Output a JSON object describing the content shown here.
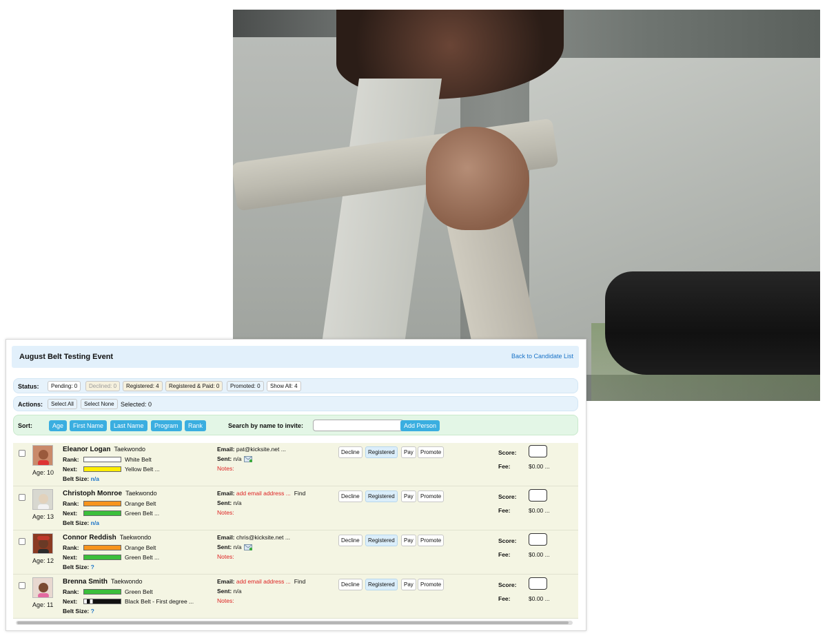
{
  "event": {
    "title": "August Belt Testing Event",
    "back_link": "Back to Candidate List"
  },
  "status": {
    "label": "Status:",
    "chips": [
      "Pending: 0",
      "Declined: 0",
      "Registered: 4",
      "Registered & Paid: 0",
      "Promoted: 0",
      "Show All: 4"
    ]
  },
  "actions": {
    "label": "Actions:",
    "select_all": "Select All",
    "select_none": "Select None",
    "selected": "Selected: 0"
  },
  "sort": {
    "label": "Sort:",
    "buttons": [
      "Age",
      "First Name",
      "Last Name",
      "Program",
      "Rank"
    ],
    "search_label": "Search by name to invite:",
    "add_person": "Add Person"
  },
  "row_labels": {
    "rank": "Rank:",
    "next": "Next:",
    "belt_size": "Belt Size:",
    "email": "Email:",
    "sent": "Sent:",
    "notes": "Notes:",
    "score": "Score:",
    "fee": "Fee:",
    "find": "Find",
    "decline": "Decline",
    "registered": "Registered",
    "pay": "Pay",
    "promote": "Promote"
  },
  "students": [
    {
      "name": "Eleanor Logan",
      "program": "Taekwondo",
      "age": "Age: 10",
      "rank": "White Belt",
      "rank_color": "#ffffff",
      "next": "Yellow Belt ...",
      "next_color": "#ffee00",
      "belt_size": "n/a",
      "email": "pat@kicksite.net ...",
      "email_missing": "",
      "sent": "n/a",
      "fee": "$0.00 ...",
      "avatar_bg": "#c98a6a",
      "avatar_face": "#9a5a3c"
    },
    {
      "name": "Christoph Monroe",
      "program": "Taekwondo",
      "age": "Age: 13",
      "rank": "Orange Belt",
      "rank_color": "#f7941d",
      "next": "Green Belt ...",
      "next_color": "#3bbf3b",
      "belt_size": "n/a",
      "email": "",
      "email_missing": "add email address ...",
      "sent": "n/a",
      "fee": "$0.00 ...",
      "avatar_bg": "#d8d8d0",
      "avatar_face": "#e2d2bc"
    },
    {
      "name": "Connor Reddish",
      "program": "Taekwondo",
      "age": "Age: 12",
      "rank": "Orange Belt",
      "rank_color": "#f7941d",
      "next": "Green Belt ...",
      "next_color": "#3bbf3b",
      "belt_size": "?",
      "email": "chris@kicksite.net ...",
      "email_missing": "",
      "sent": "n/a",
      "fee": "$0.00 ...",
      "avatar_bg": "#8a3a22",
      "avatar_face": "#6a3a26"
    },
    {
      "name": "Brenna Smith",
      "program": "Taekwondo",
      "age": "Age: 11",
      "rank": "Green Belt",
      "rank_color": "#3bbf3b",
      "next": "Black Belt - First degree ...",
      "next_color": "#111111",
      "belt_size": "?",
      "email": "",
      "email_missing": "add email address ...",
      "sent": "n/a",
      "fee": "$0.00 ...",
      "avatar_bg": "#e8d8d0",
      "avatar_face": "#7a4a32"
    }
  ],
  "colors": {
    "link": "#1a73c7",
    "sort_button": "#3aaee0",
    "row_bg": "#f4f5e3",
    "warning_text": "#dd2222"
  }
}
